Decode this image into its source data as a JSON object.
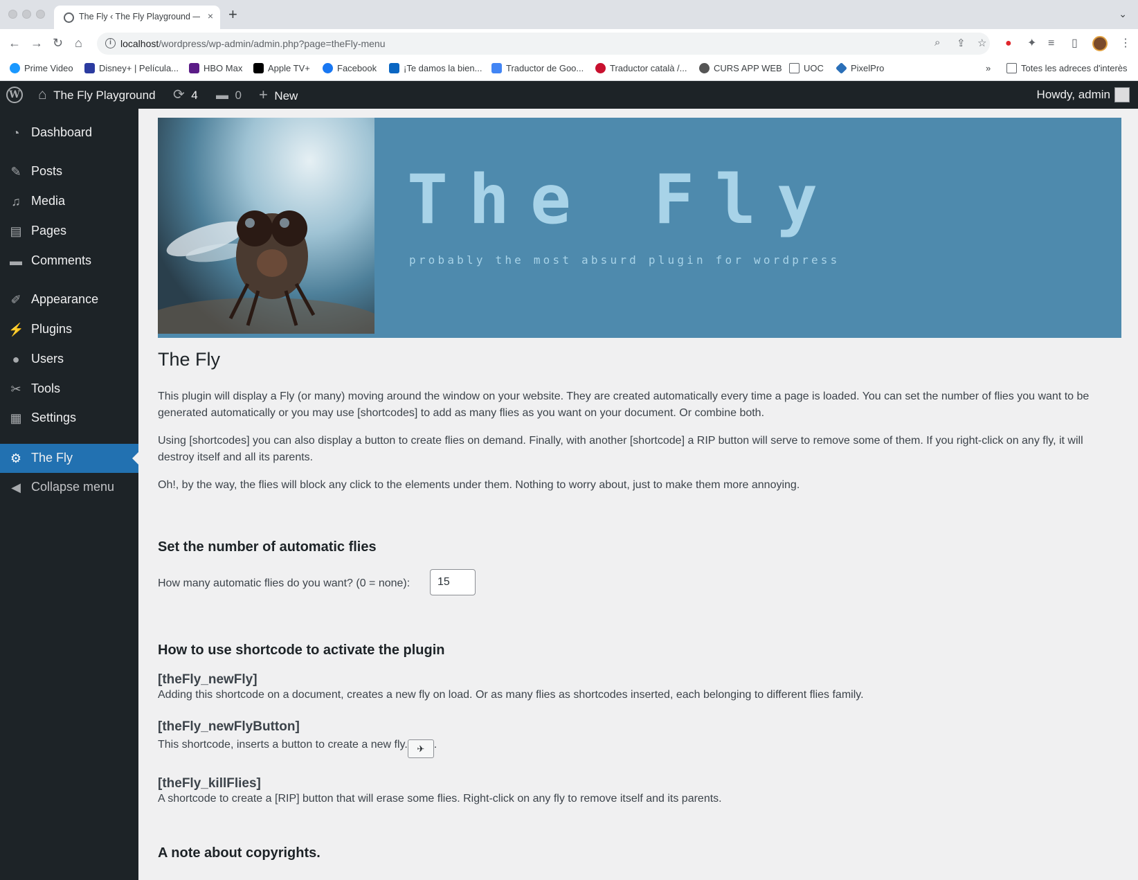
{
  "browser": {
    "tab_title": "The Fly ‹ The Fly Playground —",
    "url_host": "localhost",
    "url_path": "/wordpress/wp-admin/admin.php?page=theFly-menu",
    "bookmarks": [
      {
        "label": "Prime Video",
        "color": "#1a98ff"
      },
      {
        "label": "Disney+ | Película...",
        "color": "#2b3ba0"
      },
      {
        "label": "HBO Max",
        "color": "#5b1c87"
      },
      {
        "label": "Apple TV+",
        "color": "#000000"
      },
      {
        "label": "Facebook",
        "color": "#1877f2"
      },
      {
        "label": "¡Te damos la bien...",
        "color": "#0a66c2"
      },
      {
        "label": "Traductor de Goo...",
        "color": "#4285f4"
      },
      {
        "label": "Traductor català /...",
        "color": "#c8102e"
      },
      {
        "label": "CURS APP WEB",
        "color": "#555555"
      },
      {
        "label": "UOC",
        "color": "#5f6368"
      },
      {
        "label": "PixelPro",
        "color": "#2a6fb8"
      }
    ],
    "bookmarks_overflow": "»",
    "other_bookmarks": "Totes les adreces d'interès"
  },
  "adminbar": {
    "site_name": "The Fly Playground",
    "updates_count": "4",
    "comments_count": "0",
    "new_label": "New",
    "howdy": "Howdy, admin"
  },
  "sidebar": {
    "items": [
      {
        "label": "Dashboard",
        "icon": "dashboard-icon"
      },
      {
        "label": "Posts",
        "icon": "pin-icon"
      },
      {
        "label": "Media",
        "icon": "media-icon"
      },
      {
        "label": "Pages",
        "icon": "pages-icon"
      },
      {
        "label": "Comments",
        "icon": "comment-icon"
      },
      {
        "label": "Appearance",
        "icon": "brush-icon"
      },
      {
        "label": "Plugins",
        "icon": "plug-icon"
      },
      {
        "label": "Users",
        "icon": "user-icon"
      },
      {
        "label": "Tools",
        "icon": "wrench-icon"
      },
      {
        "label": "Settings",
        "icon": "settings-icon"
      },
      {
        "label": "The Fly",
        "icon": "gear-icon"
      },
      {
        "label": "Collapse menu",
        "icon": "collapse-icon"
      }
    ]
  },
  "banner": {
    "title": "The Fly",
    "subtitle": "probably the most absurd plugin for wordpress"
  },
  "main": {
    "title": "The Fly",
    "intro": [
      "This plugin will display a Fly (or many) moving around the window on your website. They are created automatically every time a page is loaded. You can set the number of flies you want to be generated automatically or you may use [shortcodes] to add as many flies as you want on your document. Or combine both.",
      "Using [shortcodes] you can also display a button to create flies on demand. Finally, with another [shortcode] a RIP button will serve to remove some of them. If you right-click on any fly, it will destroy itself and all its parents.",
      "Oh!, by the way, the flies will block any click to the elements under them. Nothing to worry about, just to make them more annoying."
    ],
    "auto_section_title": "Set the number of automatic flies",
    "auto_label": "How many automatic flies do you want? (0 = none):",
    "auto_value": "15",
    "shortcode_section_title": "How to use shortcode to activate the plugin",
    "shortcodes": [
      {
        "name": "[theFly_newFly]",
        "desc": "Adding this shortcode on a document, creates a new fly on load. Or as many flies as shortcodes inserted, each belonging to different flies family."
      },
      {
        "name": "[theFly_newFlyButton]",
        "desc": "This shortcode, inserts a button to create a new fly.",
        "suffix": "."
      },
      {
        "name": "[theFly_killFlies]",
        "desc": "A shortcode to create a [RIP] button that will erase some flies. Right-click on any fly to remove itself and its parents."
      }
    ],
    "copyright_title": "A note about copyrights."
  }
}
